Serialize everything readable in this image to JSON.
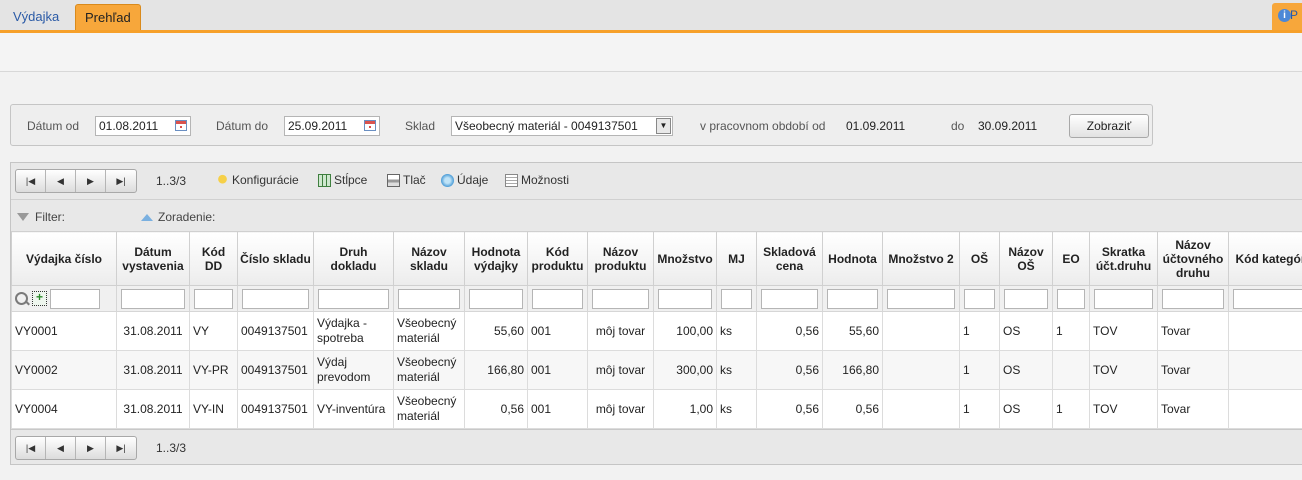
{
  "tabs": [
    {
      "label": "Výdajka",
      "active": false
    },
    {
      "label": "Prehľad",
      "active": true
    }
  ],
  "top_right": {
    "icon": "info-icon",
    "text": "P"
  },
  "filter_panel": {
    "date_from_label": "Dátum od",
    "date_from_value": "01.08.2011",
    "date_to_label": "Dátum do",
    "date_to_value": "25.09.2011",
    "warehouse_label": "Sklad",
    "warehouse_value": "Všeobecný materiál - 0049137501",
    "period_from_label": "v pracovnom období od",
    "period_from_value": "01.09.2011",
    "period_to_label": "do",
    "period_to_value": "30.09.2011",
    "show_button": "Zobraziť"
  },
  "toolbar": {
    "page_info": "1..3/3",
    "items": [
      "Konfigurácie",
      "Stĺpce",
      "Tlač",
      "Údaje",
      "Možnosti"
    ]
  },
  "filter_row": {
    "filter_label": "Filter:",
    "sort_label": "Zoradenie:"
  },
  "columns": [
    "Výdajka číslo",
    "Dátum vystavenia",
    "Kód DD",
    "Číslo skladu",
    "Druh dokladu",
    "Názov skladu",
    "Hodnota výdajky",
    "Kód produktu",
    "Názov produktu",
    "Množstvo",
    "MJ",
    "Skladová cena",
    "Hodnota",
    "Množstvo 2",
    "OŠ",
    "Názov OŠ",
    "EO",
    "Skratka účt.druhu",
    "Názov účtovného druhu",
    "Kód kategórie"
  ],
  "rows": [
    [
      "VY0001",
      "31.08.2011",
      "VY",
      "0049137501",
      "Výdajka - spotreba",
      "Všeobecný materiál",
      "55,60",
      "001",
      "môj tovar",
      "100,00",
      "ks",
      "0,56",
      "55,60",
      "",
      "1",
      "OS",
      "1",
      "TOV",
      "Tovar",
      ""
    ],
    [
      "VY0002",
      "31.08.2011",
      "VY-PR",
      "0049137501",
      "Výdaj prevodom",
      "Všeobecný materiál",
      "166,80",
      "001",
      "môj tovar",
      "300,00",
      "ks",
      "0,56",
      "166,80",
      "",
      "1",
      "OS",
      "",
      "TOV",
      "Tovar",
      ""
    ],
    [
      "VY0004",
      "31.08.2011",
      "VY-IN",
      "0049137501",
      "VY-inventúra",
      "Všeobecný materiál",
      "0,56",
      "001",
      "môj tovar",
      "1,00",
      "ks",
      "0,56",
      "0,56",
      "",
      "1",
      "OS",
      "1",
      "TOV",
      "Tovar",
      ""
    ]
  ],
  "bottom_pager": {
    "page_info": "1..3/3"
  },
  "colors": {
    "accent": "#f7a73b",
    "link": "#2a5aa6"
  }
}
